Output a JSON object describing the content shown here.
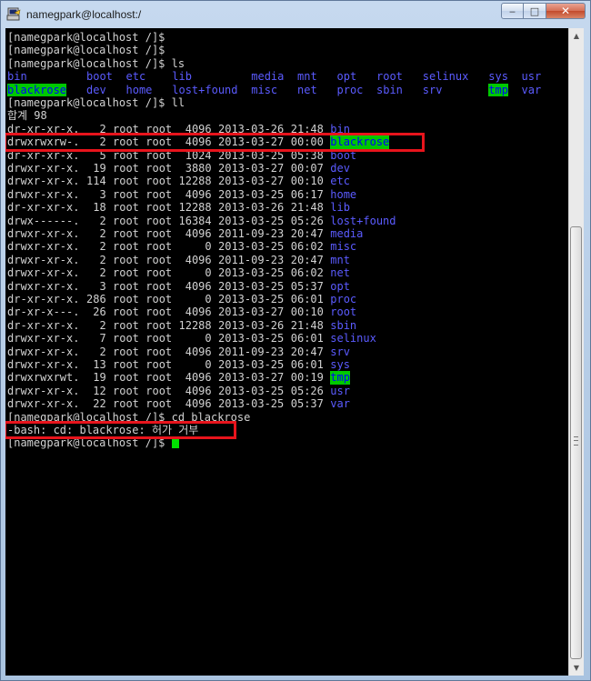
{
  "window": {
    "title": "namegpark@localhost:/",
    "icon": "putty-terminal-icon",
    "controls": {
      "minimize": "‒",
      "maximize": "□",
      "close": "✕"
    }
  },
  "terminal": {
    "lines": [
      {
        "text": "[namegpark@localhost /]$"
      },
      {
        "text": "[namegpark@localhost /]$"
      },
      {
        "text": "[namegpark@localhost /]$ ls"
      }
    ],
    "ls_output": {
      "row1": [
        "bin",
        "boot",
        "etc",
        "lib",
        "media",
        "mnt",
        "opt",
        "root",
        "selinux",
        "sys",
        "usr"
      ],
      "row2": [
        "blackrose",
        "dev",
        "home",
        "lost+found",
        "misc",
        "net",
        "proc",
        "sbin",
        "srv",
        "tmp",
        "var"
      ]
    },
    "ll_prompt": "[namegpark@localhost /]$ ll",
    "total": "합계 98",
    "ll_rows": [
      {
        "perm": "dr-xr-xr-x.",
        "links": "2",
        "owner": "root",
        "group": "root",
        "size": "4096",
        "date": "2013-03-26",
        "time": "21:48",
        "name": "bin"
      },
      {
        "perm": "drwxrwxrw-.",
        "links": "2",
        "owner": "root",
        "group": "root",
        "size": "4096",
        "date": "2013-03-27",
        "time": "00:00",
        "name": "blackrose"
      },
      {
        "perm": "dr-xr-xr-x.",
        "links": "5",
        "owner": "root",
        "group": "root",
        "size": "1024",
        "date": "2013-03-25",
        "time": "05:38",
        "name": "boot"
      },
      {
        "perm": "drwxr-xr-x.",
        "links": "19",
        "owner": "root",
        "group": "root",
        "size": "3880",
        "date": "2013-03-27",
        "time": "00:07",
        "name": "dev"
      },
      {
        "perm": "drwxr-xr-x.",
        "links": "114",
        "owner": "root",
        "group": "root",
        "size": "12288",
        "date": "2013-03-27",
        "time": "00:10",
        "name": "etc"
      },
      {
        "perm": "drwxr-xr-x.",
        "links": "3",
        "owner": "root",
        "group": "root",
        "size": "4096",
        "date": "2013-03-25",
        "time": "06:17",
        "name": "home"
      },
      {
        "perm": "dr-xr-xr-x.",
        "links": "18",
        "owner": "root",
        "group": "root",
        "size": "12288",
        "date": "2013-03-26",
        "time": "21:48",
        "name": "lib"
      },
      {
        "perm": "drwx------.",
        "links": "2",
        "owner": "root",
        "group": "root",
        "size": "16384",
        "date": "2013-03-25",
        "time": "05:26",
        "name": "lost+found"
      },
      {
        "perm": "drwxr-xr-x.",
        "links": "2",
        "owner": "root",
        "group": "root",
        "size": "4096",
        "date": "2011-09-23",
        "time": "20:47",
        "name": "media"
      },
      {
        "perm": "drwxr-xr-x.",
        "links": "2",
        "owner": "root",
        "group": "root",
        "size": "0",
        "date": "2013-03-25",
        "time": "06:02",
        "name": "misc"
      },
      {
        "perm": "drwxr-xr-x.",
        "links": "2",
        "owner": "root",
        "group": "root",
        "size": "4096",
        "date": "2011-09-23",
        "time": "20:47",
        "name": "mnt"
      },
      {
        "perm": "drwxr-xr-x.",
        "links": "2",
        "owner": "root",
        "group": "root",
        "size": "0",
        "date": "2013-03-25",
        "time": "06:02",
        "name": "net"
      },
      {
        "perm": "drwxr-xr-x.",
        "links": "3",
        "owner": "root",
        "group": "root",
        "size": "4096",
        "date": "2013-03-25",
        "time": "05:37",
        "name": "opt"
      },
      {
        "perm": "dr-xr-xr-x.",
        "links": "286",
        "owner": "root",
        "group": "root",
        "size": "0",
        "date": "2013-03-25",
        "time": "06:01",
        "name": "proc"
      },
      {
        "perm": "dr-xr-x---.",
        "links": "26",
        "owner": "root",
        "group": "root",
        "size": "4096",
        "date": "2013-03-27",
        "time": "00:10",
        "name": "root"
      },
      {
        "perm": "dr-xr-xr-x.",
        "links": "2",
        "owner": "root",
        "group": "root",
        "size": "12288",
        "date": "2013-03-26",
        "time": "21:48",
        "name": "sbin"
      },
      {
        "perm": "drwxr-xr-x.",
        "links": "7",
        "owner": "root",
        "group": "root",
        "size": "0",
        "date": "2013-03-25",
        "time": "06:01",
        "name": "selinux"
      },
      {
        "perm": "drwxr-xr-x.",
        "links": "2",
        "owner": "root",
        "group": "root",
        "size": "4096",
        "date": "2011-09-23",
        "time": "20:47",
        "name": "srv"
      },
      {
        "perm": "drwxr-xr-x.",
        "links": "13",
        "owner": "root",
        "group": "root",
        "size": "0",
        "date": "2013-03-25",
        "time": "06:01",
        "name": "sys"
      },
      {
        "perm": "drwxrwxrwt.",
        "links": "19",
        "owner": "root",
        "group": "root",
        "size": "4096",
        "date": "2013-03-27",
        "time": "00:19",
        "name": "tmp"
      },
      {
        "perm": "drwxr-xr-x.",
        "links": "12",
        "owner": "root",
        "group": "root",
        "size": "4096",
        "date": "2013-03-25",
        "time": "05:26",
        "name": "usr"
      },
      {
        "perm": "drwxr-xr-x.",
        "links": "22",
        "owner": "root",
        "group": "root",
        "size": "4096",
        "date": "2013-03-25",
        "time": "05:37",
        "name": "var"
      }
    ],
    "cd_prompt": "[namegpark@localhost /]$ cd blackrose",
    "error": "-bash: cd: blackrose: 허가 거부",
    "final_prompt": "[namegpark@localhost /]$ ",
    "highlighted_dirs": [
      "blackrose",
      "tmp"
    ],
    "colors": {
      "background": "#000000",
      "text": "#d2d2d2",
      "directory": "#5b5bff",
      "highlight_bg": "#00c800",
      "cursor": "#00e000",
      "annotation": "#e8141c"
    }
  }
}
